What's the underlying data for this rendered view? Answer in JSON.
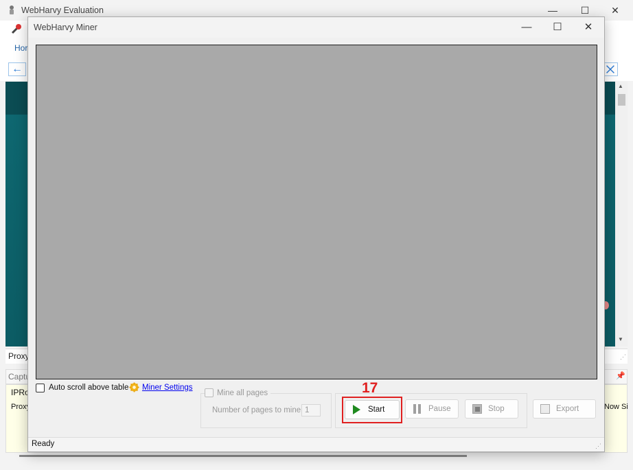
{
  "background_window": {
    "title": "WebHarvy Evaluation",
    "home_tab_label": "Hor",
    "proxy_bar_text": "Proxy",
    "capture_header": "Captu",
    "capture_row1": "IPRo",
    "capture_row2": "Proxy",
    "capture_row2_right": "Now Si",
    "controls": {
      "minimize": "—",
      "maximize": "☐",
      "close": "✕"
    }
  },
  "dialog": {
    "title": "WebHarvy Miner",
    "controls": {
      "minimize": "—",
      "maximize": "☐",
      "close": "✕"
    },
    "auto_scroll_label": "Auto scroll above table",
    "auto_scroll_checked": false,
    "miner_settings_link": "Miner Settings",
    "mine_all_pages_label": "Mine all pages",
    "mine_all_pages_checked": false,
    "pages_to_mine_label": "Number of pages to mine",
    "pages_to_mine_value": "1",
    "step_badge": "17",
    "buttons": {
      "start": "Start",
      "pause": "Pause",
      "stop": "Stop",
      "export": "Export"
    },
    "status": "Ready"
  },
  "colors": {
    "preview_bg": "#a9a9a9",
    "highlight": "#e02020",
    "link": "#0000ee",
    "start_icon": "#1f8a1f"
  }
}
